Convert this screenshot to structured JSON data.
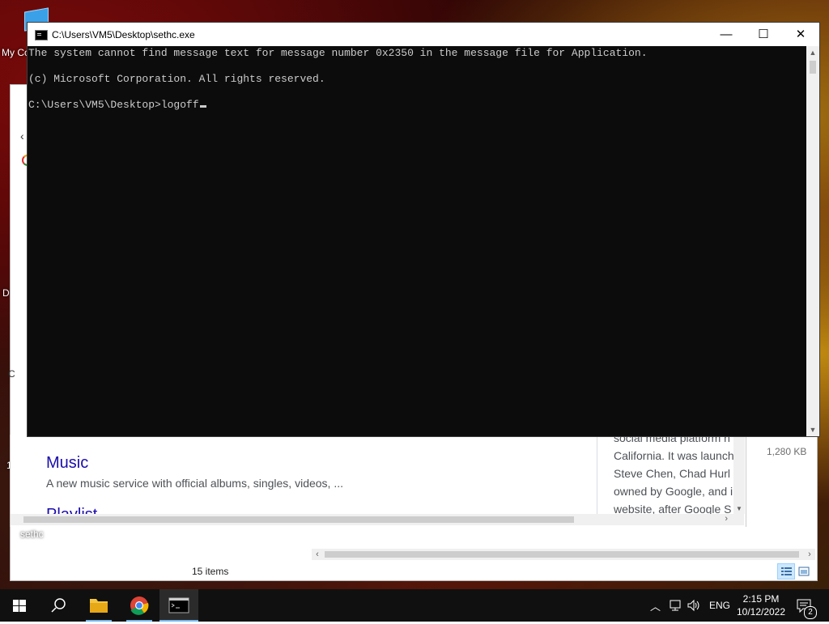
{
  "desktop": {
    "icon_label_partial": "My Co",
    "edge_letters": [
      "D",
      "C",
      "1"
    ],
    "sethc_label": "sethc"
  },
  "explorer": {
    "status_items": "15 items",
    "size_value": "1,280 KB"
  },
  "browser": {
    "result_title": "Music",
    "result_desc": "A new music service with official albums, singles, videos, ...",
    "result_title2": "Playlist",
    "side_card_lines": [
      "social media platform h",
      "California. It was launch",
      "Steve Chen, Chad Hurl",
      "owned by Google, and i",
      "website, after Google S"
    ]
  },
  "cmd": {
    "title": "C:\\Users\\VM5\\Desktop\\sethc.exe",
    "lines": [
      "The system cannot find message text for message number 0x2350 in the message file for Application.",
      "",
      "(c) Microsoft Corporation. All rights reserved.",
      "",
      "C:\\Users\\VM5\\Desktop>logoff"
    ],
    "buttons": {
      "minimize": "—",
      "maximize": "☐",
      "close": "✕"
    }
  },
  "taskbar": {
    "apps": [
      "start",
      "search",
      "file-explorer",
      "chrome",
      "command-prompt"
    ],
    "language": "ENG",
    "time": "2:15 PM",
    "date": "10/12/2022",
    "notification_count": "2"
  }
}
